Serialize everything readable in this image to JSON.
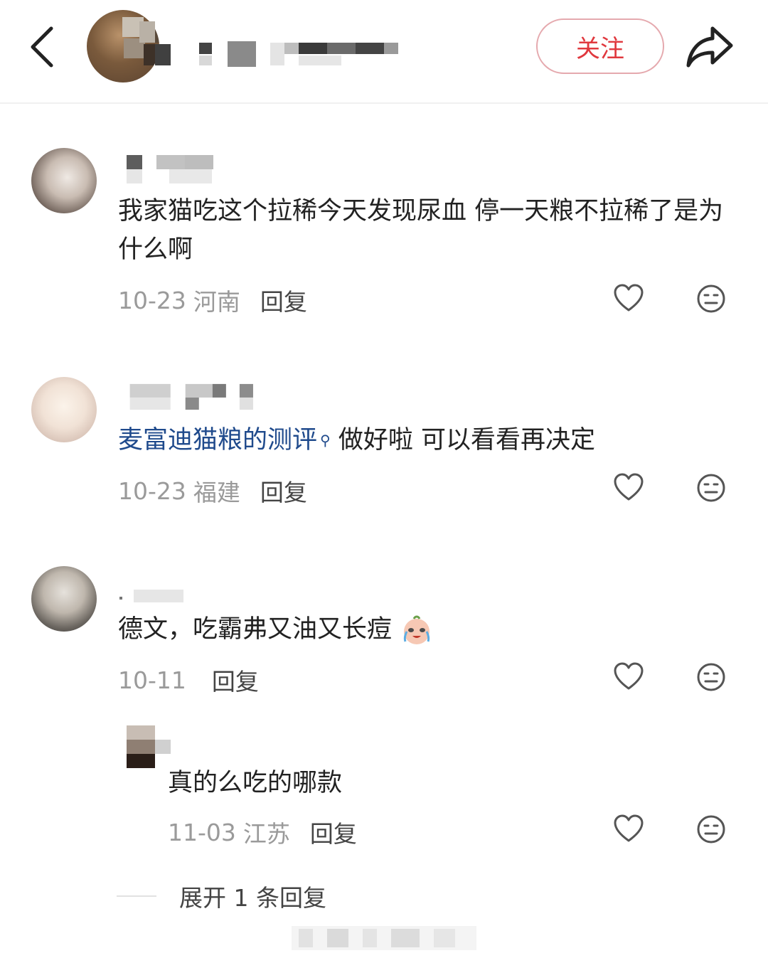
{
  "header": {
    "follow_label": "关注",
    "icons": [
      "back-icon",
      "share-icon"
    ]
  },
  "comments": [
    {
      "text": "我家猫吃这个拉稀今天发现尿血 停一天粮不拉稀了是为什么啊",
      "date": "10-23",
      "location": "河南",
      "reply_label": "回复"
    },
    {
      "link_text": "麦富迪猫粮的测评",
      "text": "做好啦 可以看看再决定",
      "date": "10-23",
      "location": "福建",
      "reply_label": "回复"
    },
    {
      "text": "德文，吃霸弗又油又长痘",
      "date": "10-11",
      "location": "",
      "reply_label": "回复",
      "sub_replies": [
        {
          "text": "真的么吃的哪款",
          "date": "11-03",
          "location": "江苏",
          "reply_label": "回复"
        }
      ],
      "expand_label": "展开 1 条回复"
    }
  ],
  "colors": {
    "accent": "#e0383e",
    "link": "#1f4a8c",
    "meta": "#9a9a9a"
  }
}
